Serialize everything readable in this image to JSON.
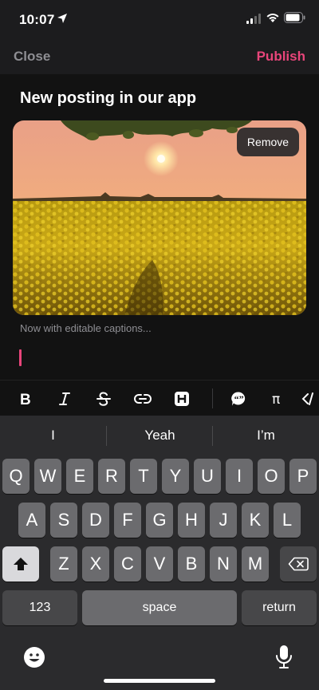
{
  "status_bar": {
    "time": "10:07"
  },
  "nav": {
    "close_label": "Close",
    "publish_label": "Publish"
  },
  "editor": {
    "title": "New posting in our app",
    "remove_label": "Remove",
    "caption_placeholder": "Now with editable captions..."
  },
  "toolbar": {
    "items": [
      "bold-icon",
      "italic-icon",
      "strikethrough-icon",
      "link-icon",
      "heading-icon",
      "quote-icon",
      "pi-icon",
      "code-icon"
    ]
  },
  "keyboard": {
    "suggestions": [
      "I",
      "Yeah",
      "I’m"
    ],
    "row1": [
      "Q",
      "W",
      "E",
      "R",
      "T",
      "Y",
      "U",
      "I",
      "O",
      "P"
    ],
    "row2": [
      "A",
      "S",
      "D",
      "F",
      "G",
      "H",
      "J",
      "K",
      "L"
    ],
    "row3": [
      "Z",
      "X",
      "C",
      "V",
      "B",
      "N",
      "M"
    ],
    "numbers_label": "123",
    "space_label": "space",
    "return_label": "return"
  },
  "colors": {
    "accent": "#e8457a",
    "muted": "#8e8e93"
  }
}
